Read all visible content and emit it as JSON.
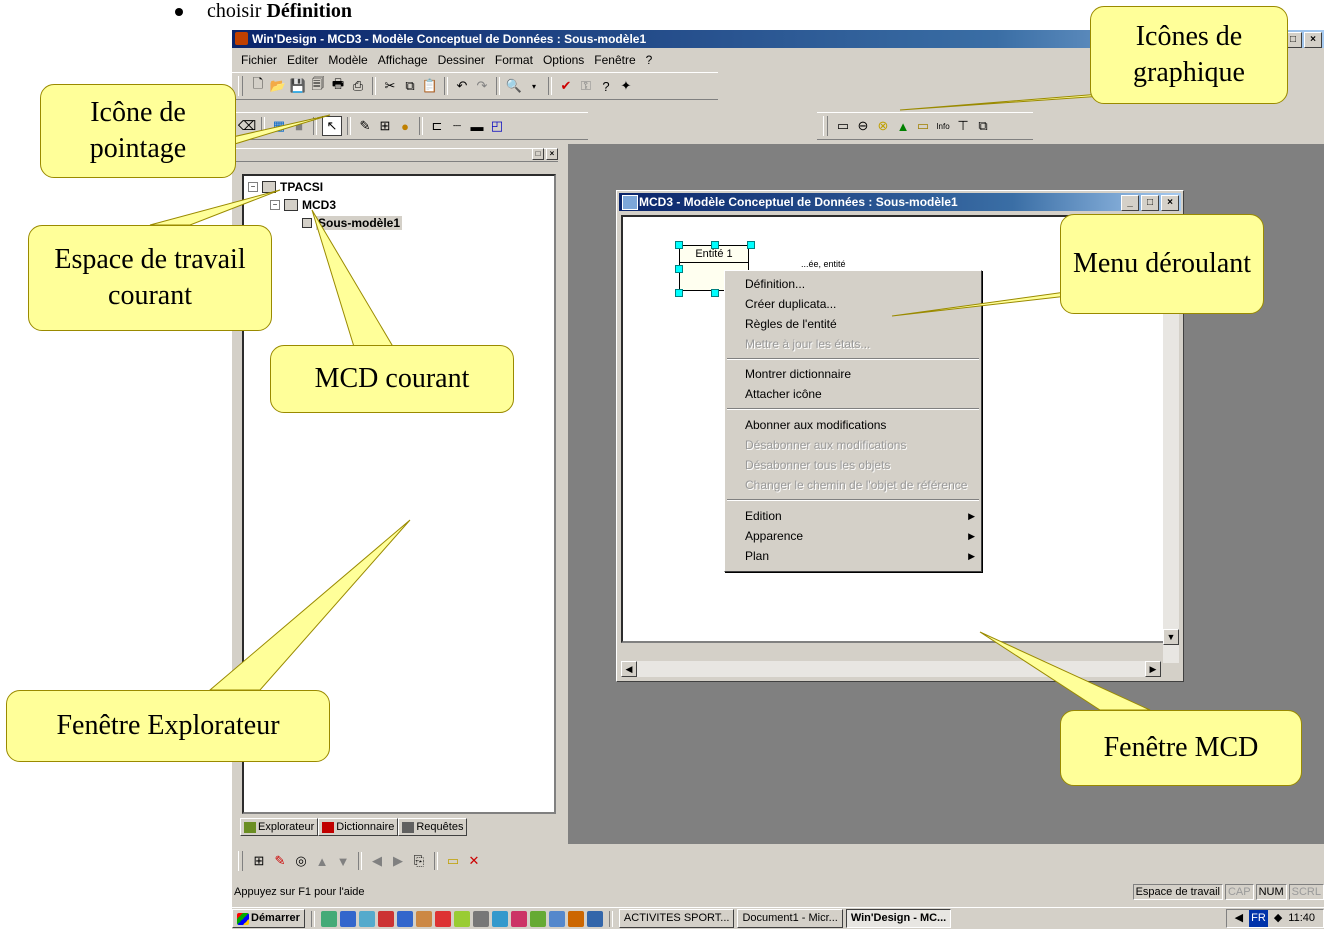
{
  "document": {
    "bullet_prefix": "choisir ",
    "bullet_bold": "Définition"
  },
  "window": {
    "title": "Win'Design - MCD3 - Modèle Conceptuel de Données : Sous-modèle1",
    "controls": [
      "_",
      "□",
      "×"
    ]
  },
  "menubar": [
    "Fichier",
    "Editer",
    "Modèle",
    "Affichage",
    "Dessiner",
    "Format",
    "Options",
    "Fenêtre",
    "?"
  ],
  "explorer": {
    "tree": [
      {
        "label": "TPACSI",
        "level": 0
      },
      {
        "label": "MCD3",
        "level": 1
      },
      {
        "label": "Sous-modèle1",
        "level": 2,
        "selected": true
      }
    ],
    "tabs": [
      "Explorateur",
      "Dictionnaire",
      "Requêtes"
    ]
  },
  "mcd_window": {
    "title": "MCD3 - Modèle Conceptuel de Données : Sous-modèle1",
    "entity": "Entité 1",
    "entity_tag": "...ée, entité"
  },
  "context_menu": {
    "items": [
      {
        "label": "Définition...",
        "disabled": false
      },
      {
        "label": "Créer duplicata...",
        "disabled": false
      },
      {
        "label": "Règles de l'entité",
        "disabled": false
      },
      {
        "label": "Mettre à jour les états...",
        "disabled": true
      },
      {
        "label": "Montrer dictionnaire",
        "disabled": false
      },
      {
        "label": "Attacher icône",
        "disabled": false
      },
      {
        "label": "Abonner aux modifications",
        "disabled": false
      },
      {
        "label": "Désabonner aux modifications",
        "disabled": true
      },
      {
        "label": "Désabonner tous les objets",
        "disabled": true
      },
      {
        "label": "Changer le chemin de l'objet de référence",
        "disabled": true
      },
      {
        "label": "Edition",
        "disabled": false,
        "submenu": true
      },
      {
        "label": "Apparence",
        "disabled": false,
        "submenu": true
      },
      {
        "label": "Plan",
        "disabled": false,
        "submenu": true
      }
    ]
  },
  "statusbar": {
    "help": "Appuyez sur F1 pour l'aide",
    "panels": [
      {
        "label": "Espace de travail",
        "active": true
      },
      {
        "label": "CAP",
        "active": false
      },
      {
        "label": "NUM",
        "active": true
      },
      {
        "label": "SCRL",
        "active": false
      }
    ]
  },
  "taskbar": {
    "start": "Démarrer",
    "tasks": [
      {
        "label": "ACTIVITES SPORT...",
        "active": false
      },
      {
        "label": "Document1 - Micr...",
        "active": false
      },
      {
        "label": "Win'Design - MC...",
        "active": true
      }
    ],
    "lang": "FR",
    "clock": "11:40"
  },
  "callouts": {
    "icone_pointage": "Icône de pointage",
    "icones_graphique": "Icônes de graphique",
    "espace_travail": "Espace de travail courant",
    "mcd_courant": "MCD courant",
    "menu_deroulant": "Menu déroulant",
    "fenetre_explorateur": "Fenêtre Explorateur",
    "fenetre_mcd": "Fenêtre MCD"
  },
  "colors": {
    "titlebar": "#0a246a",
    "callout_fill": "#ffff99",
    "mdi_background": "#808080",
    "face": "#d4d0c8"
  }
}
